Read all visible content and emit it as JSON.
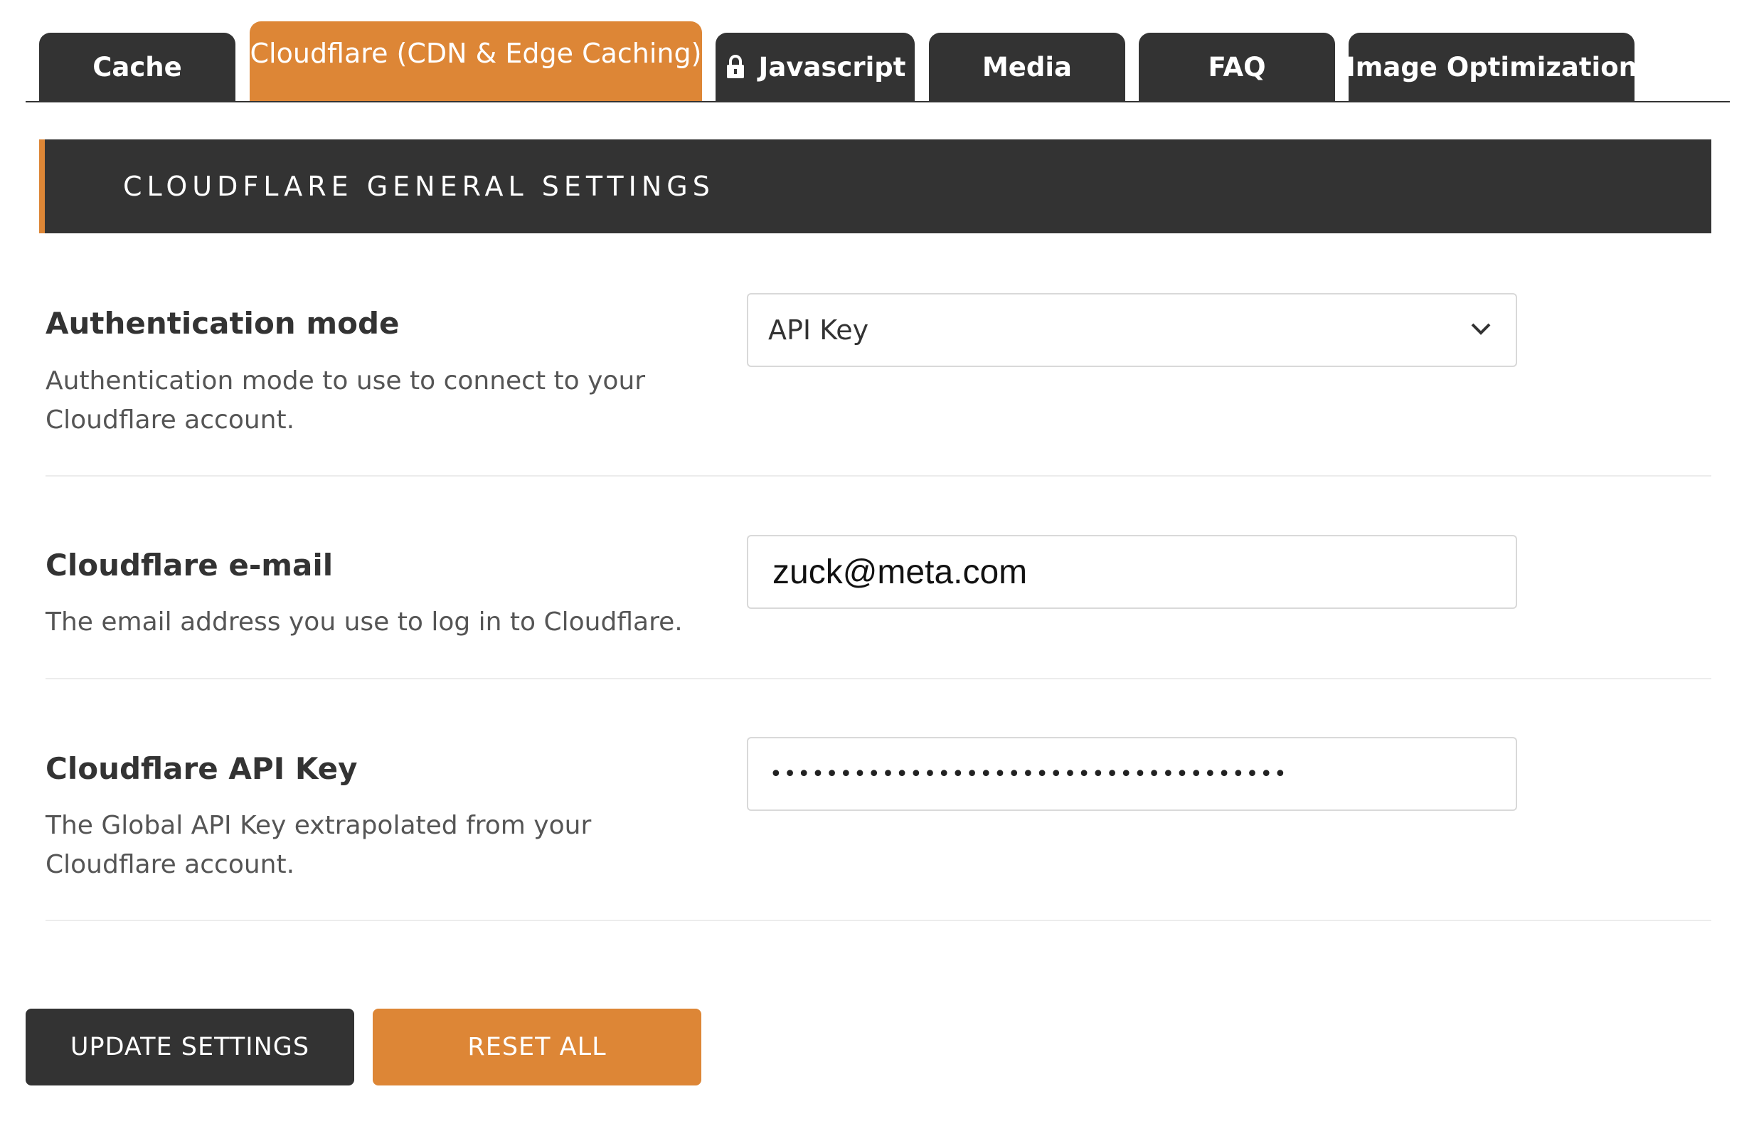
{
  "tabs": [
    {
      "label": "Cache",
      "active": false
    },
    {
      "label": "Cloudflare (CDN & Edge Caching)",
      "active": true
    },
    {
      "label": "Javascript",
      "active": false,
      "icon": "lock-icon"
    },
    {
      "label": "Media",
      "active": false
    },
    {
      "label": "FAQ",
      "active": false
    },
    {
      "label": "Image Optimization",
      "active": false
    }
  ],
  "section": {
    "title": "CLOUDFLARE GENERAL SETTINGS"
  },
  "auth_mode": {
    "label": "Authentication mode",
    "description": "Authentication mode to use to connect to your Cloudflare account.",
    "selected": "API Key"
  },
  "email": {
    "label": "Cloudflare e-mail",
    "description": "The email address you use to log in to Cloudflare.",
    "value": "zuck@meta.com"
  },
  "api_key": {
    "label": "Cloudflare API Key",
    "description": "The Global API Key extrapolated from your Cloudflare account.",
    "masked_value": "•••••••••••••••••••••••••••••••••••••"
  },
  "buttons": {
    "update": "UPDATE SETTINGS",
    "reset": "RESET ALL"
  },
  "colors": {
    "dark": "#333333",
    "accent": "#dd8636"
  }
}
